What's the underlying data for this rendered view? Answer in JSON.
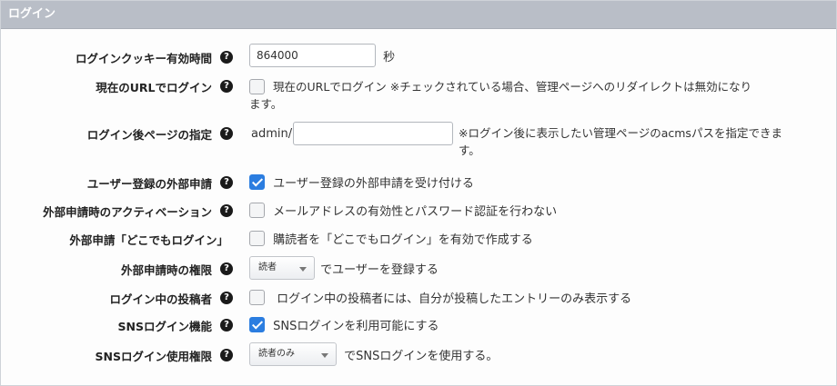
{
  "panel": {
    "title": "ログイン"
  },
  "rows": [
    {
      "label": "ログインクッキー有効時間",
      "input_value": "864000",
      "suffix": "秒"
    },
    {
      "label": "現在のURLでログイン",
      "checked": false,
      "text_line1": "現在のURLでログイン ※チェックされている場合、管理ページへのリダイレクトは無効になり",
      "text_line2": "ます。"
    },
    {
      "label": "ログイン後ページの指定",
      "prefix": "admin/",
      "input_value": "",
      "note_line1": "※ログイン後に表示したい管理ページのacmsパスを指定できま",
      "note_line2": "す。"
    },
    {
      "label": "ユーザー登録の外部申請",
      "checked": true,
      "text": "ユーザー登録の外部申請を受け付ける"
    },
    {
      "label": "外部申請時のアクティベーション",
      "checked": false,
      "text": "メールアドレスの有効性とパスワード認証を行わない"
    },
    {
      "label": "外部申請「どこでもログイン」",
      "checked": false,
      "text": "購読者を「どこでもログイン」を有効で作成する"
    },
    {
      "label": "外部申請時の権限",
      "select_value": "読者",
      "suffix": "でユーザーを登録する"
    },
    {
      "label": "ログイン中の投稿者",
      "checked": false,
      "text": "ログイン中の投稿者には、自分が投稿したエントリーのみ表示する"
    },
    {
      "label": "SNSログイン機能",
      "checked": true,
      "text": "SNSログインを利用可能にする"
    },
    {
      "label": "SNSログイン使用権限",
      "select_value": "読者のみ",
      "suffix": "でSNSログインを使用する。"
    }
  ],
  "icons": {
    "help": "question-circle-icon",
    "dropdown": "chevron-down-icon"
  },
  "colors": {
    "header_bg": "#b9bec7",
    "checkbox_checked": "#2b7de0"
  }
}
